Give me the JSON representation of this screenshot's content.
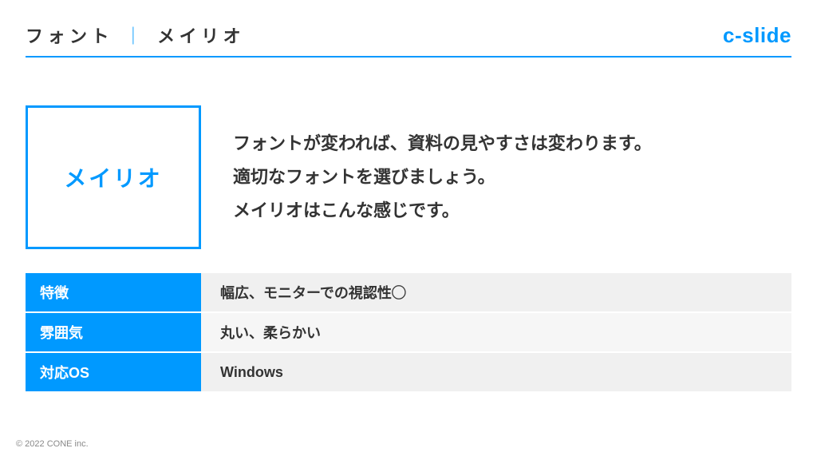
{
  "header": {
    "crumb_a": "フォント",
    "separator": "｜",
    "crumb_b": "メイリオ",
    "logo": "c-slide"
  },
  "fontbox": {
    "label": "メイリオ"
  },
  "description": {
    "line1": "フォントが変われば、資料の見やすさは変わります。",
    "line2": "適切なフォントを選びましょう。",
    "line3": "メイリオはこんな感じです。"
  },
  "table": {
    "rows": [
      {
        "key": "特徴",
        "value": "幅広、モニターでの視認性◯"
      },
      {
        "key": "雰囲気",
        "value": "丸い、柔らかい"
      },
      {
        "key": "対応OS",
        "value": "Windows"
      }
    ]
  },
  "footer": {
    "copyright": "© 2022 CONE inc."
  }
}
